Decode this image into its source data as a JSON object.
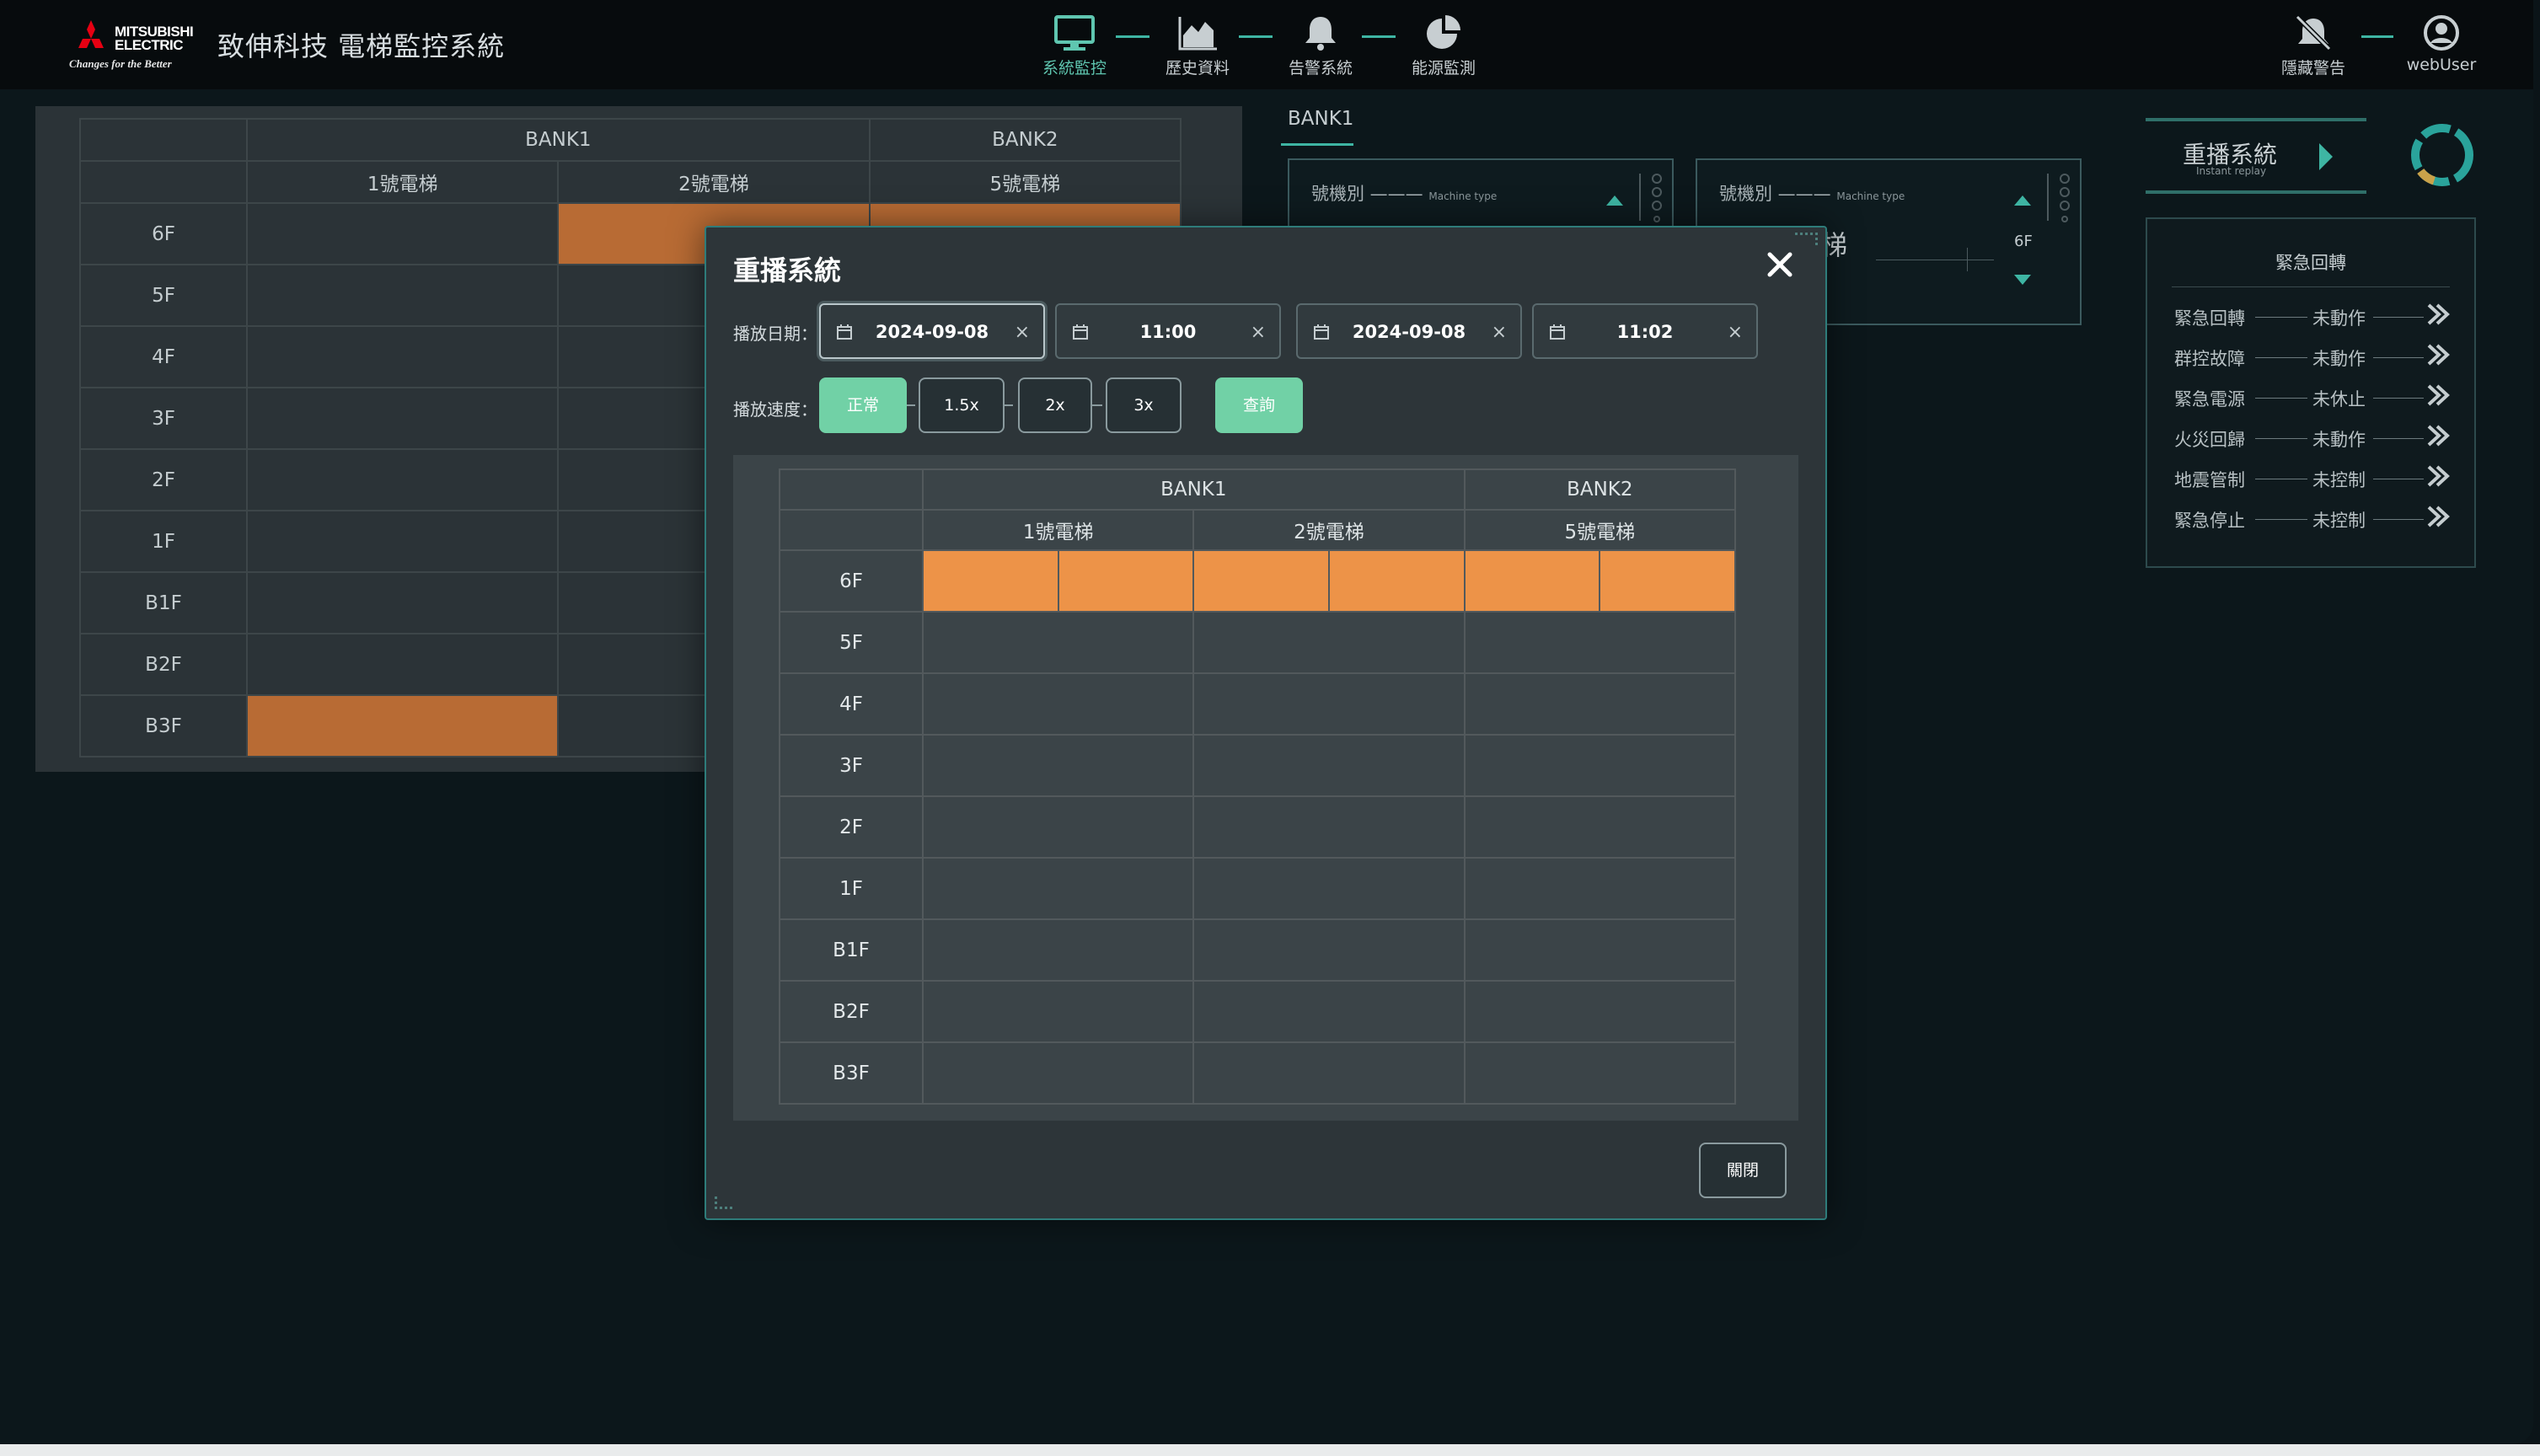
{
  "header": {
    "brand_line1": "MITSUBISHI",
    "brand_line2": "ELECTRIC",
    "brand_tagline": "Changes for the Better",
    "app_title": "致伸科技 電梯監控系統",
    "nav": [
      {
        "label": "系統監控",
        "icon": "monitor-icon",
        "active": true
      },
      {
        "label": "歷史資料",
        "icon": "area-chart-icon",
        "active": false
      },
      {
        "label": "告警系統",
        "icon": "bell-icon",
        "active": false
      },
      {
        "label": "能源監測",
        "icon": "pie-chart-icon",
        "active": false
      }
    ],
    "hide_alert_label": "隱藏警告",
    "user_label": "webUser"
  },
  "background_grid": {
    "banks": [
      "BANK1",
      "BANK2"
    ],
    "elevators": [
      "1號電梯",
      "2號電梯",
      "5號電梯"
    ],
    "floors": [
      "6F",
      "5F",
      "4F",
      "3F",
      "2F",
      "1F",
      "B1F",
      "B2F",
      "B3F"
    ]
  },
  "right_side": {
    "bank_tab": "BANK1",
    "machine_type_label": "號機別",
    "machine_type_sub": "Machine type",
    "partial_elevator_text": "梯",
    "floor_indicator": "6F",
    "replay_title": "重播系統",
    "replay_sub": "Instant replay",
    "emergency_title": "緊急回轉",
    "emergency_rows": [
      {
        "name": "緊急回轉",
        "status": "未動作"
      },
      {
        "name": "群控故障",
        "status": "未動作"
      },
      {
        "name": "緊急電源",
        "status": "未休止"
      },
      {
        "name": "火災回歸",
        "status": "未動作"
      },
      {
        "name": "地震管制",
        "status": "未控制"
      },
      {
        "name": "緊急停止",
        "status": "未控制"
      }
    ]
  },
  "modal": {
    "title": "重播系統",
    "date_label": "播放日期：",
    "start_date": "2024-09-08",
    "start_time": "11:00",
    "end_date": "2024-09-08",
    "end_time": "11:02",
    "speed_label": "播放速度：",
    "speeds": [
      "正常",
      "1.5x",
      "2x",
      "3x"
    ],
    "active_speed": "正常",
    "query_label": "查詢",
    "close_label": "關閉",
    "table": {
      "banks": [
        "BANK1",
        "BANK2"
      ],
      "elevators": [
        "1號電梯",
        "2號電梯",
        "5號電梯"
      ],
      "floors": [
        "6F",
        "5F",
        "4F",
        "3F",
        "2F",
        "1F",
        "B1F",
        "B2F",
        "B3F"
      ]
    }
  },
  "colors": {
    "accent": "#3eb5a3",
    "active_button": "#71d1a6",
    "elevator_car_dim": "#b86b34",
    "elevator_car": "#ed9348"
  }
}
